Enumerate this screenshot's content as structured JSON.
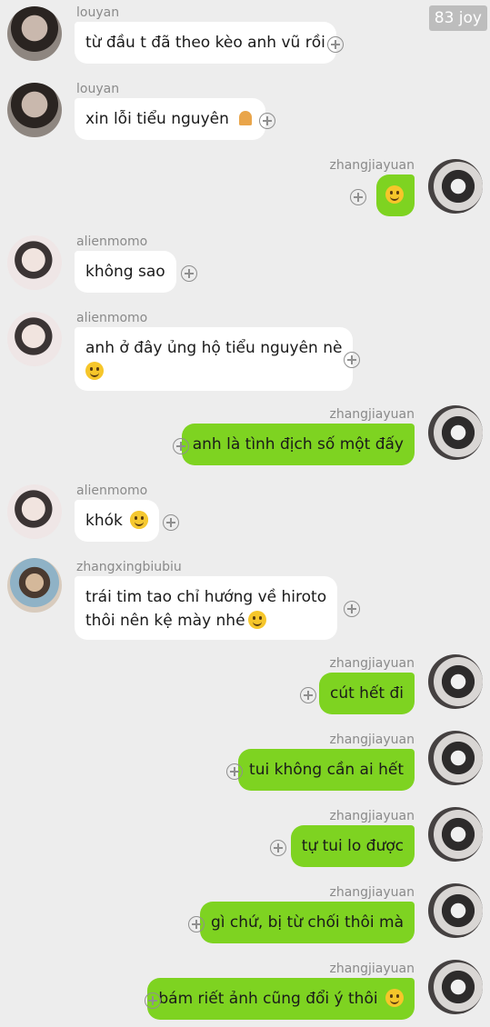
{
  "watermark": "83 joy",
  "messages": [
    {
      "side": "left",
      "sender": "louyan",
      "lines": [
        "từ đầu t đã theo kèo anh vũ rồi"
      ],
      "emoji": ""
    },
    {
      "side": "left",
      "sender": "louyan",
      "lines": [
        "xin lỗi tiểu nguyên"
      ],
      "emoji": "folded-hands-emoji"
    },
    {
      "side": "right",
      "sender": "zhangjiayuan",
      "lines": [
        ""
      ],
      "emoji": "smiling-face-emoji"
    },
    {
      "side": "left",
      "sender": "alienmomo",
      "lines": [
        "không sao"
      ],
      "emoji": ""
    },
    {
      "side": "left",
      "sender": "alienmomo",
      "lines": [
        "anh ở đây ủng hộ tiểu nguyên nè",
        ""
      ],
      "emoji": "grinning-face-emoji"
    },
    {
      "side": "right",
      "sender": "zhangjiayuan",
      "lines": [
        "anh là tình địch số một đấy"
      ],
      "emoji": ""
    },
    {
      "side": "left",
      "sender": "alienmomo",
      "lines": [
        "khók"
      ],
      "emoji": "crying-face-emoji"
    },
    {
      "side": "left",
      "sender": "zhangxingbiubiu",
      "lines": [
        "trái tim tao chỉ hướng về hiroto",
        "thôi nên kệ mày nhé"
      ],
      "emoji": "smiling-face-emoji"
    },
    {
      "side": "right",
      "sender": "zhangjiayuan",
      "lines": [
        "cút hết đi"
      ],
      "emoji": ""
    },
    {
      "side": "right",
      "sender": "zhangjiayuan",
      "lines": [
        "tui không cần ai hết"
      ],
      "emoji": ""
    },
    {
      "side": "right",
      "sender": "zhangjiayuan",
      "lines": [
        "tự tui lo được"
      ],
      "emoji": ""
    },
    {
      "side": "right",
      "sender": "zhangjiayuan",
      "lines": [
        "gì chứ, bị từ chối thôi mà"
      ],
      "emoji": ""
    },
    {
      "side": "right",
      "sender": "zhangjiayuan",
      "lines": [
        "bám riết ảnh cũng đổi ý thôi"
      ],
      "emoji": "smiling-face-emoji"
    }
  ],
  "colors": {
    "background": "#ededed",
    "incoming_bubble": "#ffffff",
    "outgoing_bubble": "#7ed321"
  }
}
